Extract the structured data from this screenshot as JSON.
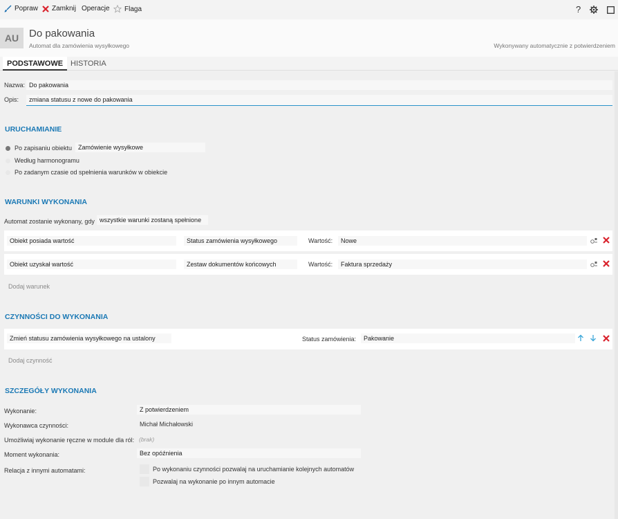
{
  "toolbar": {
    "popraw": "Popraw",
    "zamknij": "Zamknij",
    "operacje": "Operacje",
    "flaga": "Flaga",
    "help": "?"
  },
  "header": {
    "avatar": "AU",
    "title": "Do pakowania",
    "subtitle": "Automat dla zamówienia wysyłkowego",
    "right_note": "Wykonywany automatycznie z potwierdzeniem"
  },
  "tabs": [
    "PODSTAWOWE",
    "HISTORIA"
  ],
  "basic": {
    "nazwa_label": "Nazwa:",
    "nazwa_value": "Do pakowania",
    "opis_label": "Opis:",
    "opis_value": "zmiana statusu z nowe do pakowania"
  },
  "uruchamianie": {
    "heading": "URUCHAMIANIE",
    "options": [
      {
        "label": "Po zapisaniu obiektu",
        "checked": true,
        "value": "Zamówienie wysyłkowe"
      },
      {
        "label": "Według harmonogramu",
        "checked": false
      },
      {
        "label": "Po zadanym czasie od spełnienia warunków w obiekcie",
        "checked": false
      }
    ]
  },
  "warunki": {
    "heading": "WARUNKI WYKONANIA",
    "intro_label": "Automat zostanie wykonany, gdy",
    "intro_value": "wszystkie warunki zostaną spełnione",
    "rows": [
      {
        "condition": "Obiekt posiada wartość",
        "field": "Status zamówienia wysyłkowego",
        "value_label": "Wartość:",
        "value": "Nowe"
      },
      {
        "condition": "Obiekt uzyskał wartość",
        "field": "Zestaw dokumentów końcowych",
        "value_label": "Wartość:",
        "value": "Faktura sprzedaży"
      }
    ],
    "add_label": "Dodaj warunek"
  },
  "czynnosci": {
    "heading": "CZYNNOŚCI DO WYKONANIA",
    "rows": [
      {
        "action": "Zmień statusu zamówienia wysyłkowego na ustalony",
        "param_label": "Status zamówienia:",
        "param_value": "Pakowanie"
      }
    ],
    "add_label": "Dodaj czynność"
  },
  "szczegoly": {
    "heading": "SZCZEGÓŁY WYKONANIA",
    "wykonanie_label": "Wykonanie:",
    "wykonanie_value": "Z potwierdzeniem",
    "wykonawca_label": "Wykonawca czynności:",
    "wykonawca_value": "Michał Michałowski",
    "reczne_label": "Umożliwiaj wykonanie ręczne w module dla ról:",
    "reczne_value": "(brak)",
    "moment_label": "Moment wykonania:",
    "moment_value": "Bez opóźnienia",
    "relacja_label": "Relacja z innymi automatami:",
    "relacja_options": [
      {
        "label": "Po wykonaniu czynności pozwalaj na uruchamianie kolejnych automatów",
        "checked": false
      },
      {
        "label": "Pozwalaj na wykonanie po innym automacie",
        "checked": false
      }
    ]
  },
  "colors": {
    "accent": "#1b79b5",
    "delete": "#d9232d",
    "arrow": "#3aa6d8"
  }
}
